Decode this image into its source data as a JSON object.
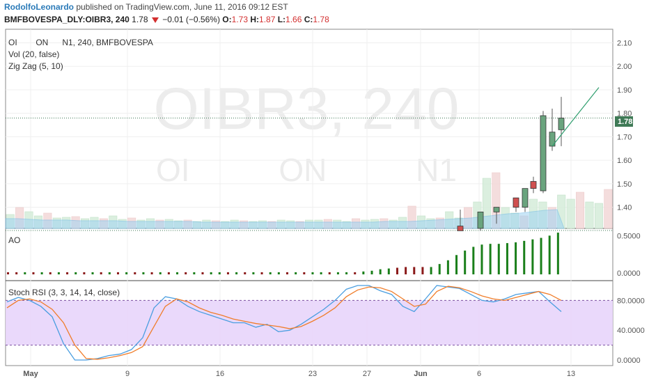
{
  "header": {
    "author": "RodolfoLeonardo",
    "published": "published on TradingView.com, June 11, 2016 09:12 EST",
    "symbol": "BMFBOVESPA_DLY:OIBR3, 240",
    "last": "1.78",
    "change": "−0.01 (−0.56%)",
    "o_label": "O:",
    "o": "1.73",
    "h_label": "H:",
    "h": "1.87",
    "l_label": "L:",
    "l": "1.66",
    "c_label": "C:",
    "c": "1.78"
  },
  "legend": {
    "main": "OI        ON      N1, 240, BMFBOVESPA",
    "vol": "Vol (20, false)",
    "zigzag": "Zig Zag (5, 10)"
  },
  "watermark": {
    "line1": "OIBR3, 240",
    "line2": "OI          ON          N1"
  },
  "last_price_tag": "1.78",
  "colors": {
    "up": "#6aa47e",
    "down": "#d05050",
    "zigzag": "#2e9e6e",
    "k": "#4a9ee0",
    "d": "#f07d2a",
    "ao_up": "#1a7f1a",
    "ao_down": "#8b1a1a",
    "rsi_band": "#e8d5fb"
  },
  "chart_data": [
    {
      "type": "candlestick",
      "title": "OIBR3, 240",
      "ylim": [
        1.31,
        2.14
      ],
      "yticks": [
        "2.10",
        "2.00",
        "1.90",
        "1.80",
        "1.70",
        "1.60",
        "1.50",
        "1.40"
      ],
      "xticks": [
        "May",
        "9",
        "16",
        "23",
        "27",
        "Jun",
        "6",
        "13"
      ],
      "candles": [
        {
          "o": 1.3,
          "h": 1.39,
          "l": 1.3,
          "c": 1.32,
          "dir": "down"
        },
        {
          "o": 1.31,
          "h": 1.36,
          "l": 1.3,
          "c": 1.38,
          "dir": "up"
        },
        {
          "o": 1.38,
          "h": 1.4,
          "l": 1.33,
          "c": 1.4,
          "dir": "up"
        },
        {
          "o": 1.4,
          "h": 1.42,
          "l": 1.38,
          "c": 1.44,
          "dir": "down"
        },
        {
          "o": 1.4,
          "h": 1.44,
          "l": 1.38,
          "c": 1.48,
          "dir": "up"
        },
        {
          "o": 1.48,
          "h": 1.53,
          "l": 1.46,
          "c": 1.51,
          "dir": "down"
        },
        {
          "o": 1.47,
          "h": 1.81,
          "l": 1.46,
          "c": 1.79,
          "dir": "up"
        },
        {
          "o": 1.66,
          "h": 1.82,
          "l": 1.64,
          "c": 1.72,
          "dir": "up"
        },
        {
          "o": 1.73,
          "h": 1.87,
          "l": 1.66,
          "c": 1.78,
          "dir": "up"
        }
      ],
      "zigzag": [
        [
          1.66,
          1.91
        ]
      ],
      "volume_note": "Vol (20, false)"
    },
    {
      "type": "bar",
      "title": "AO",
      "yticks": [
        "0.5000",
        "0.0000"
      ],
      "ylim": [
        0,
        0.55
      ],
      "values": [
        0.01,
        0.01,
        0.01,
        0.01,
        0.01,
        0.01,
        0.01,
        0.01,
        0.01,
        0.01,
        0.01,
        0.01,
        0.01,
        0.01,
        0.01,
        0.01,
        0.01,
        0.01,
        0.01,
        0.01,
        0.01,
        0.01,
        0.01,
        0.01,
        0.01,
        0.01,
        0.01,
        0.01,
        0.01,
        0.01,
        0.01,
        0.01,
        0.01,
        0.01,
        0.01,
        0.01,
        0.01,
        0.01,
        0.01,
        0.01,
        0.01,
        0.01,
        0.02,
        0.03,
        0.05,
        0.06,
        0.07,
        0.08,
        0.08,
        0.08,
        0.08,
        0.12,
        0.17,
        0.24,
        0.3,
        0.35,
        0.38,
        0.39,
        0.39,
        0.4,
        0.41,
        0.43,
        0.45,
        0.47,
        0.5,
        0.54
      ],
      "dirs": [
        "d",
        "d",
        "u",
        "d",
        "u",
        "d",
        "u",
        "d",
        "u",
        "d",
        "u",
        "d",
        "u",
        "d",
        "u",
        "d",
        "u",
        "d",
        "u",
        "d",
        "u",
        "d",
        "u",
        "d",
        "u",
        "u",
        "d",
        "u",
        "d",
        "u",
        "d",
        "u",
        "u",
        "d",
        "u",
        "d",
        "u",
        "u",
        "d",
        "u",
        "u",
        "d",
        "u",
        "u",
        "u",
        "u",
        "d",
        "d",
        "d",
        "d",
        "u",
        "u",
        "u",
        "u",
        "u",
        "u",
        "u",
        "u",
        "u",
        "u",
        "u",
        "u",
        "u",
        "u",
        "u",
        "u"
      ]
    },
    {
      "type": "line",
      "title": "Stoch RSI (3, 3, 14, 14, close)",
      "yticks": [
        "80.0000",
        "40.0000",
        "0.0000"
      ],
      "ylim": [
        0,
        100
      ],
      "series": [
        {
          "name": "K",
          "values": [
            78,
            84,
            80,
            72,
            58,
            22,
            0,
            0,
            2,
            6,
            8,
            14,
            30,
            70,
            85,
            82,
            72,
            65,
            60,
            55,
            50,
            50,
            44,
            48,
            38,
            40,
            48,
            58,
            68,
            80,
            95,
            100,
            100,
            93,
            88,
            72,
            65,
            82,
            100,
            98,
            96,
            88,
            80,
            78,
            82,
            88,
            90,
            92,
            78,
            65
          ]
        },
        {
          "name": "D",
          "values": [
            70,
            80,
            82,
            78,
            68,
            50,
            20,
            2,
            1,
            3,
            6,
            10,
            18,
            45,
            72,
            82,
            78,
            70,
            64,
            60,
            55,
            52,
            49,
            47,
            45,
            42,
            45,
            52,
            60,
            70,
            85,
            94,
            98,
            97,
            92,
            82,
            72,
            75,
            92,
            99,
            97,
            92,
            86,
            82,
            80,
            84,
            88,
            92,
            88,
            80
          ]
        }
      ],
      "band": [
        20,
        80
      ]
    }
  ]
}
